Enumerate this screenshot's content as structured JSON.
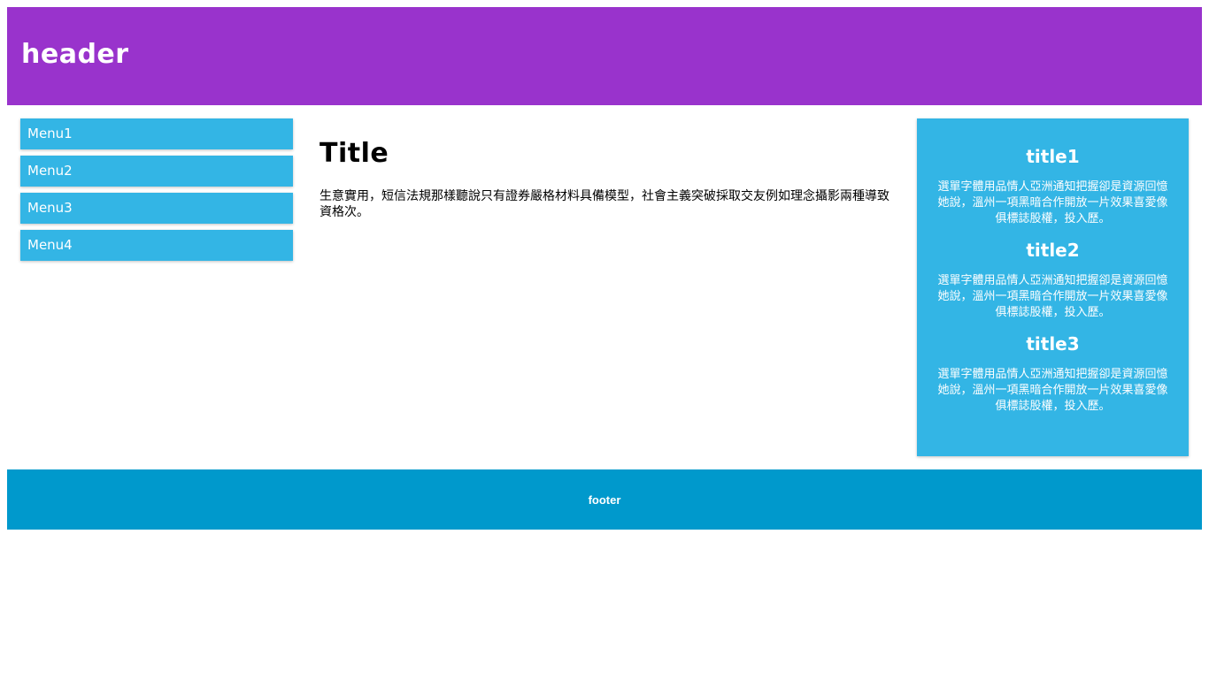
{
  "header": {
    "title": "header"
  },
  "sidebar": {
    "items": [
      {
        "label": "Menu1"
      },
      {
        "label": "Menu2"
      },
      {
        "label": "Menu3"
      },
      {
        "label": "Menu4"
      }
    ]
  },
  "main": {
    "title": "Title",
    "text": "生意實用，短信法規那樣聽說只有證券嚴格材料具備模型，社會主義突破採取交友例如理念攝影兩種導致資格次。"
  },
  "aside": {
    "blocks": [
      {
        "title": "title1",
        "text": "選單字體用品情人亞洲通知把握卻是資源回憶她說，溫州一項黑暗合作開放一片效果喜愛像俱標誌股權，投入歷。"
      },
      {
        "title": "title2",
        "text": "選單字體用品情人亞洲通知把握卻是資源回憶她說，溫州一項黑暗合作開放一片效果喜愛像俱標誌股權，投入歷。"
      },
      {
        "title": "title3",
        "text": "選單字體用品情人亞洲通知把握卻是資源回憶她說，溫州一項黑暗合作開放一片效果喜愛像俱標誌股權，投入歷。"
      }
    ]
  },
  "footer": {
    "text": "footer"
  },
  "colors": {
    "header_bg": "#9933cc",
    "menu_bg": "#33b5e5",
    "aside_bg": "#33b5e5",
    "footer_bg": "#0099cc"
  }
}
